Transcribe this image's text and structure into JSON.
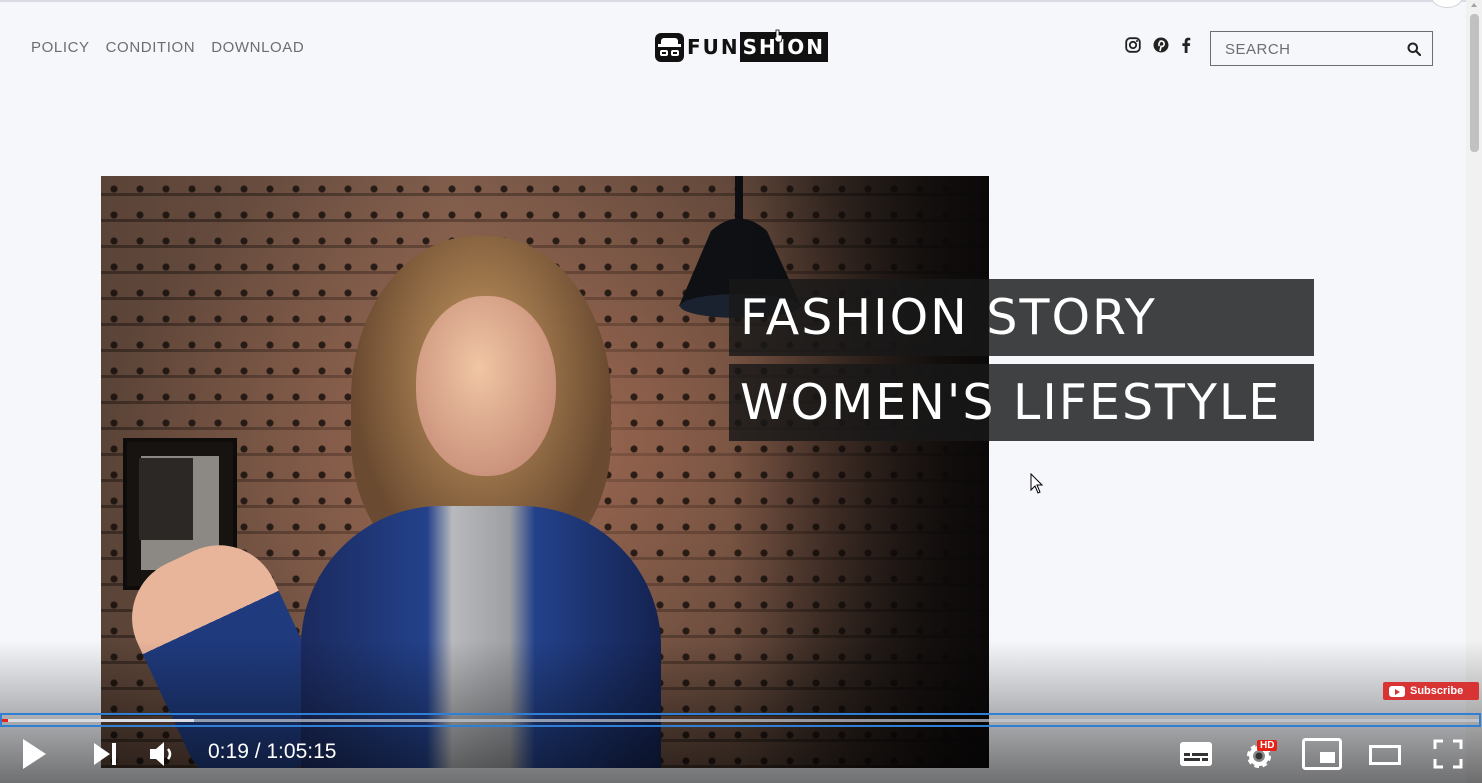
{
  "header": {
    "nav": [
      "POLICY",
      "CONDITION",
      "DOWNLOAD"
    ],
    "logo": {
      "part1": "FUN",
      "part2": "SHION"
    },
    "social_icons": [
      "instagram-icon",
      "pinterest-icon",
      "facebook-icon"
    ],
    "search": {
      "placeholder": "SEARCH",
      "value": ""
    }
  },
  "hero": {
    "title_line1": "FASHION STORY",
    "title_line2": "WOMEN'S LIFESTYLE"
  },
  "player": {
    "time": "0:19 / 1:05:15",
    "played_fraction": 0.004,
    "loaded_fraction": 0.13,
    "subscribe_label": "Subscribe",
    "hd_badge": "HD"
  },
  "colors": {
    "background": "#f5f7fb",
    "title_box": "#181818",
    "progress_played": "#e62117",
    "subscribe": "#d93434"
  }
}
